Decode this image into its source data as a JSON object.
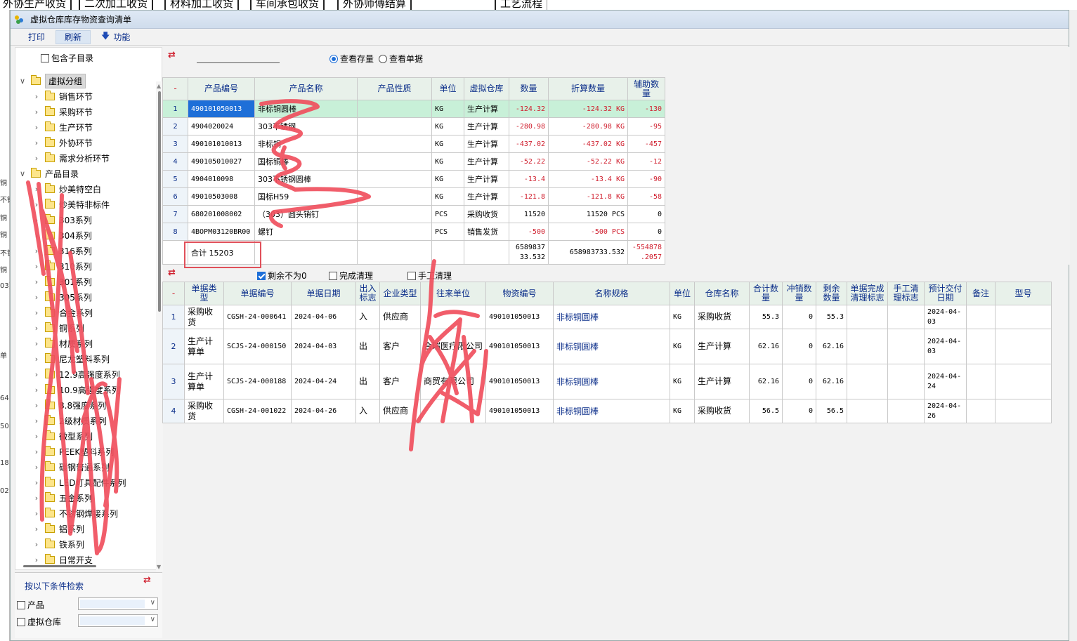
{
  "background": {
    "tabs": [
      "外协生产收货",
      "二次加工收货",
      "材料加工收货",
      "车间承包收货",
      "外协师傅结算",
      "工艺流程"
    ],
    "left_fragments": [
      "铜",
      "不锈",
      "铜",
      "铜",
      "不锈",
      "铜",
      "03)",
      "单",
      "64",
      "50",
      "18",
      "02"
    ]
  },
  "window": {
    "title": "虚拟仓库库存物资查询清单",
    "icon": "app-icon"
  },
  "toolbar": {
    "print": "打印",
    "refresh": "刷新",
    "function": "功能",
    "function_icon": "arrow-down-icon"
  },
  "left_panel": {
    "include_subdir_label": "包含子目录",
    "include_subdir_checked": false,
    "tree": [
      {
        "label": "虚拟分组",
        "level": 0,
        "expanded": true,
        "selected": true
      },
      {
        "label": "销售环节",
        "level": 1
      },
      {
        "label": "采购环节",
        "level": 1
      },
      {
        "label": "生产环节",
        "level": 1
      },
      {
        "label": "外协环节",
        "level": 1
      },
      {
        "label": "需求分析环节",
        "level": 1
      },
      {
        "label": "产品目录",
        "level": 0,
        "expanded": true
      },
      {
        "label": "炒美特空白",
        "level": 1
      },
      {
        "label": "炒美特非标件",
        "level": 1
      },
      {
        "label": "303系列",
        "level": 1
      },
      {
        "label": "304系列",
        "level": 1
      },
      {
        "label": "316系列",
        "level": 1
      },
      {
        "label": "310系列",
        "level": 1
      },
      {
        "label": "301系列",
        "level": 1
      },
      {
        "label": "305系列",
        "level": 1
      },
      {
        "label": "合金系列",
        "level": 1
      },
      {
        "label": "铜系列",
        "level": 1
      },
      {
        "label": "材质系列",
        "level": 1
      },
      {
        "label": "尼龙塑料系列",
        "level": 1
      },
      {
        "label": "12.9高强度系列",
        "level": 1
      },
      {
        "label": "10.9高强度系列",
        "level": 1
      },
      {
        "label": "8.8强度系列",
        "level": 1
      },
      {
        "label": "2级材质系列",
        "level": 1
      },
      {
        "label": "微型系列",
        "level": 1
      },
      {
        "label": "PEEK塑料系列",
        "level": 1
      },
      {
        "label": "碳钢普通系列",
        "level": 1
      },
      {
        "label": "LED灯具配件系列",
        "level": 1
      },
      {
        "label": "五金系列",
        "level": 1
      },
      {
        "label": "不锈钢焊接系列",
        "level": 1
      },
      {
        "label": "铝系列",
        "level": 1
      },
      {
        "label": "铁系列",
        "level": 1
      },
      {
        "label": "日常开支",
        "level": 1
      }
    ]
  },
  "search_panel": {
    "title": "按以下条件检索",
    "fields": [
      {
        "label": "产品",
        "checked": false
      },
      {
        "label": "虚拟仓库",
        "checked": false
      }
    ]
  },
  "inventory": {
    "view_options": [
      {
        "label": "查看存量",
        "selected": true
      },
      {
        "label": "查看单据",
        "selected": false
      }
    ],
    "columns": [
      "-",
      "产品编号",
      "产品名称",
      "产品性质",
      "单位",
      "虚拟仓库",
      "数量",
      "折算数量",
      "辅助数量"
    ],
    "rows": [
      {
        "no": "1",
        "code": "490101050013",
        "name": "非标铜圆棒",
        "nature": "",
        "unit": "KG",
        "warehouse": "生产计算",
        "qty": "-124.32",
        "conv": "-124.32 KG",
        "aux": "-130"
      },
      {
        "no": "2",
        "code": "4904020024",
        "name": "303不锈钢",
        "nature": "",
        "unit": "KG",
        "warehouse": "生产计算",
        "qty": "-280.98",
        "conv": "-280.98 KG",
        "aux": "-95"
      },
      {
        "no": "3",
        "code": "490101010013",
        "name": "非标铜",
        "nature": "",
        "unit": "KG",
        "warehouse": "生产计算",
        "qty": "-437.02",
        "conv": "-437.02 KG",
        "aux": "-457"
      },
      {
        "no": "4",
        "code": "490105010027",
        "name": "国标铜棒",
        "nature": "",
        "unit": "KG",
        "warehouse": "生产计算",
        "qty": "-52.22",
        "conv": "-52.22 KG",
        "aux": "-12"
      },
      {
        "no": "5",
        "code": "4904010098",
        "name": "303不锈钢圆棒",
        "nature": "",
        "unit": "KG",
        "warehouse": "生产计算",
        "qty": "-13.4",
        "conv": "-13.4 KG",
        "aux": "-90"
      },
      {
        "no": "6",
        "code": "49010503008",
        "name": "国标H59",
        "nature": "",
        "unit": "KG",
        "warehouse": "生产计算",
        "qty": "-121.8",
        "conv": "-121.8 KG",
        "aux": "-58"
      },
      {
        "no": "7",
        "code": "680201008002",
        "name": "（303）圆头销钉",
        "nature": "",
        "unit": "PCS",
        "warehouse": "采购收货",
        "qty": "11520",
        "conv": "11520 PCS",
        "aux": "0"
      },
      {
        "no": "8",
        "code": "4BOPM03120BR00",
        "name": "螺钉",
        "nature": "",
        "unit": "PCS",
        "warehouse": "销售发货",
        "qty": "-500",
        "conv": "-500 PCS",
        "aux": "0"
      }
    ],
    "total": {
      "label": "合计 15203",
      "qty_line1": "6589837",
      "qty_line2": "33.532",
      "conv": "658983733.532",
      "aux_line1": "-554878",
      "aux_line2": ".2057"
    }
  },
  "detail_filters": [
    {
      "label": "剩余不为0",
      "checked": true
    },
    {
      "label": "完成清理",
      "checked": false
    },
    {
      "label": "手工清理",
      "checked": false
    }
  ],
  "detail": {
    "columns": [
      "-",
      "单据类型",
      "单据编号",
      "单据日期",
      "出入标志",
      "企业类型",
      "往来单位",
      "物资编号",
      "名称规格",
      "单位",
      "仓库名称",
      "合计数量",
      "冲销数量",
      "剩余数量",
      "单据完成清理标志",
      "手工清理标志",
      "预计交付日期",
      "备注",
      "型号"
    ],
    "rows": [
      {
        "no": "1",
        "type": "采购收货",
        "doc": "CGSH-24-000641",
        "date": "2024-04-06",
        "io": "入",
        "ent": "供应商",
        "partner": "",
        "item": "490101050013",
        "spec": "非标铜圆棒",
        "unit": "KG",
        "wh": "采购收货",
        "total": "55.3",
        "offset": "0",
        "remain": "55.3",
        "done": "",
        "manual": "",
        "due": "2024-04-03",
        "note": "",
        "model": ""
      },
      {
        "no": "2",
        "type": "生产计算单",
        "doc": "SCJS-24-000150",
        "date": "2024-04-03",
        "io": "出",
        "ent": "客户",
        "partner": "合瑞医疗限公司",
        "item": "490101050013",
        "spec": "非标铜圆棒",
        "unit": "KG",
        "wh": "生产计算",
        "total": "62.16",
        "offset": "0",
        "remain": "62.16",
        "done": "",
        "manual": "",
        "due": "2024-04-03",
        "note": "",
        "model": ""
      },
      {
        "no": "3",
        "type": "生产计算单",
        "doc": "SCJS-24-000188",
        "date": "2024-04-24",
        "io": "出",
        "ent": "客户",
        "partner": "商贸有限公司",
        "item": "490101050013",
        "spec": "非标铜圆棒",
        "unit": "KG",
        "wh": "生产计算",
        "total": "62.16",
        "offset": "0",
        "remain": "62.16",
        "done": "",
        "manual": "",
        "due": "2024-04-24",
        "note": "",
        "model": ""
      },
      {
        "no": "4",
        "type": "采购收货",
        "doc": "CGSH-24-001022",
        "date": "2024-04-26",
        "io": "入",
        "ent": "供应商",
        "partner": "",
        "item": "490101050013",
        "spec": "非标铜圆棒",
        "unit": "KG",
        "wh": "采购收货",
        "total": "56.5",
        "offset": "0",
        "remain": "56.5",
        "done": "",
        "manual": "",
        "due": "2024-04-26",
        "note": "",
        "model": ""
      }
    ]
  },
  "colors": {
    "header_text": "#0b2e8a",
    "negative": "#d0202f",
    "highlight_row": "#c8f0d8",
    "selection": "#1e6fd8",
    "annotation": "#e0505a"
  }
}
